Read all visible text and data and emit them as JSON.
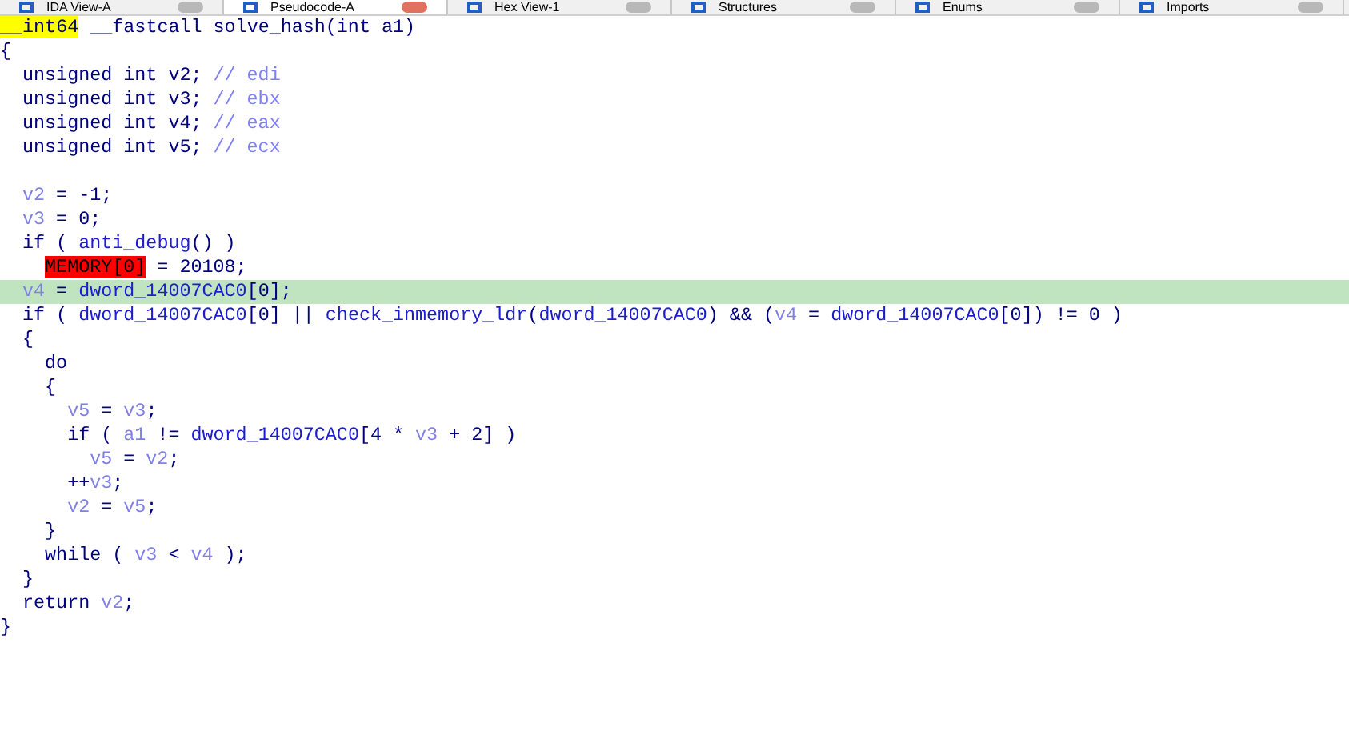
{
  "tabs": [
    {
      "label": "IDA View-A",
      "selected": false
    },
    {
      "label": "Pseudocode-A",
      "selected": true
    },
    {
      "label": "Hex View-1",
      "selected": false
    },
    {
      "label": "Structures",
      "selected": false
    },
    {
      "label": "Enums",
      "selected": false
    },
    {
      "label": "Imports",
      "selected": false
    }
  ],
  "code": [
    {
      "selected": false,
      "segments": [
        {
          "kind": "yellow",
          "text": "__int64"
        },
        {
          "kind": "plain",
          "text": " __fastcall solve_hash(int a1)"
        }
      ]
    },
    {
      "selected": false,
      "segments": [
        {
          "kind": "plain",
          "text": "{"
        }
      ],
      "children": [
        {
          "selected": false,
          "segments": [
            {
              "kind": "plain",
              "text": "unsigned int v2; "
            },
            {
              "kind": "comment",
              "text": "// edi"
            }
          ]
        },
        {
          "selected": false,
          "segments": [
            {
              "kind": "plain",
              "text": "unsigned int v3; "
            },
            {
              "kind": "comment",
              "text": "// ebx"
            }
          ]
        },
        {
          "selected": false,
          "segments": [
            {
              "kind": "plain",
              "text": "unsigned int v4; "
            },
            {
              "kind": "comment",
              "text": "// eax"
            }
          ]
        },
        {
          "selected": false,
          "segments": [
            {
              "kind": "plain",
              "text": "unsigned int v5; "
            },
            {
              "kind": "comment",
              "text": "// ecx"
            }
          ]
        },
        {
          "selected": false
        },
        {
          "selected": false,
          "segments": [
            {
              "kind": "var",
              "text": "v2"
            },
            {
              "kind": "plain",
              "text": " = -1;"
            }
          ]
        },
        {
          "selected": false,
          "segments": [
            {
              "kind": "var",
              "text": "v3"
            },
            {
              "kind": "plain",
              "text": " = 0;"
            }
          ]
        },
        {
          "selected": false,
          "segments": [
            {
              "kind": "plain",
              "text": "if ( "
            },
            {
              "kind": "func",
              "text": "anti_debug"
            },
            {
              "kind": "plain",
              "text": "() )"
            }
          ],
          "children": [
            {
              "selected": false,
              "segments": [
                {
                  "kind": "red",
                  "text": "MEMORY[0]"
                },
                {
                  "kind": "plain",
                  "text": " = 20108;"
                }
              ]
            }
          ]
        },
        {
          "selected": true,
          "segments": [
            {
              "kind": "var",
              "text": "v4"
            },
            {
              "kind": "plain",
              "text": " = "
            },
            {
              "kind": "func",
              "text": "dword_14007CAC0"
            },
            {
              "kind": "plain",
              "text": "[0];"
            }
          ]
        },
        {
          "selected": false,
          "segments": [
            {
              "kind": "plain",
              "text": "if ( "
            },
            {
              "kind": "func",
              "text": "dword_14007CAC0"
            },
            {
              "kind": "plain",
              "text": "[0] || "
            },
            {
              "kind": "func",
              "text": "check_inmemory_ldr"
            },
            {
              "kind": "plain",
              "text": "("
            },
            {
              "kind": "func",
              "text": "dword_14007CAC0"
            },
            {
              "kind": "plain",
              "text": ") && ("
            },
            {
              "kind": "var",
              "text": "v4"
            },
            {
              "kind": "plain",
              "text": " = "
            },
            {
              "kind": "func",
              "text": "dword_14007CAC0"
            },
            {
              "kind": "plain",
              "text": "[0]) != 0 )"
            }
          ]
        },
        {
          "selected": false,
          "segments": [
            {
              "kind": "plain",
              "text": "{"
            }
          ],
          "children": [
            {
              "selected": false,
              "segments": [
                {
                  "kind": "plain",
                  "text": "do"
                }
              ]
            },
            {
              "selected": false,
              "segments": [
                {
                  "kind": "plain",
                  "text": "{"
                }
              ],
              "children": [
                {
                  "selected": false,
                  "segments": [
                    {
                      "kind": "var",
                      "text": "v5"
                    },
                    {
                      "kind": "plain",
                      "text": " = "
                    },
                    {
                      "kind": "var",
                      "text": "v3"
                    },
                    {
                      "kind": "plain",
                      "text": ";"
                    }
                  ]
                },
                {
                  "selected": false,
                  "segments": [
                    {
                      "kind": "plain",
                      "text": "if ( "
                    },
                    {
                      "kind": "var",
                      "text": "a1"
                    },
                    {
                      "kind": "plain",
                      "text": " != "
                    },
                    {
                      "kind": "func",
                      "text": "dword_14007CAC0"
                    },
                    {
                      "kind": "plain",
                      "text": "[4 * "
                    },
                    {
                      "kind": "var",
                      "text": "v3"
                    },
                    {
                      "kind": "plain",
                      "text": " + 2] )"
                    }
                  ],
                  "children": [
                    {
                      "selected": false,
                      "segments": [
                        {
                          "kind": "var",
                          "text": "v5"
                        },
                        {
                          "kind": "plain",
                          "text": " = "
                        },
                        {
                          "kind": "var",
                          "text": "v2"
                        },
                        {
                          "kind": "plain",
                          "text": ";"
                        }
                      ]
                    }
                  ]
                },
                {
                  "selected": false,
                  "segments": [
                    {
                      "kind": "plain",
                      "text": "++"
                    },
                    {
                      "kind": "var",
                      "text": "v3"
                    },
                    {
                      "kind": "plain",
                      "text": ";"
                    }
                  ]
                },
                {
                  "selected": false,
                  "segments": [
                    {
                      "kind": "var",
                      "text": "v2"
                    },
                    {
                      "kind": "plain",
                      "text": " = "
                    },
                    {
                      "kind": "var",
                      "text": "v5"
                    },
                    {
                      "kind": "plain",
                      "text": ";"
                    }
                  ]
                }
              ]
            },
            {
              "selected": false,
              "segments": [
                {
                  "kind": "plain",
                  "text": "}"
                }
              ]
            },
            {
              "selected": false,
              "segments": [
                {
                  "kind": "plain",
                  "text": "while ( "
                },
                {
                  "kind": "var",
                  "text": "v3"
                },
                {
                  "kind": "plain",
                  "text": " < "
                },
                {
                  "kind": "var",
                  "text": "v4"
                },
                {
                  "kind": "plain",
                  "text": " );"
                }
              ]
            }
          ]
        },
        {
          "selected": false,
          "segments": [
            {
              "kind": "plain",
              "text": "}"
            }
          ]
        },
        {
          "selected": false,
          "segments": [
            {
              "kind": "plain",
              "text": "return "
            },
            {
              "kind": "var",
              "text": "v2"
            },
            {
              "kind": "plain",
              "text": ";"
            }
          ]
        }
      ]
    },
    {
      "selected": false,
      "segments": [
        {
          "kind": "plain",
          "text": "}"
        }
      ]
    }
  ]
}
